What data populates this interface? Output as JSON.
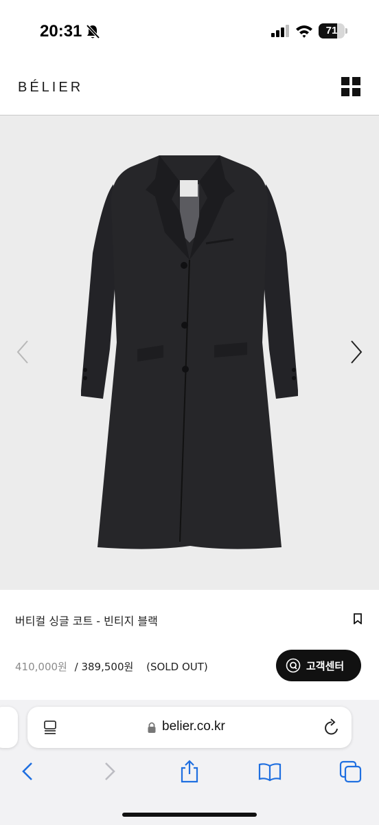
{
  "status_bar": {
    "time": "20:31",
    "battery_level": "71",
    "battery_fraction": 0.71
  },
  "site": {
    "logo": "BÉLIER"
  },
  "product": {
    "name": "버티컬 싱글 코트 - 빈티지 블랙",
    "original_price": "410,000원",
    "price_separator": "/",
    "sale_price": "389,500원",
    "status": "(SOLD OUT)"
  },
  "customer_service": {
    "label": "고객센터"
  },
  "browser": {
    "url": "belier.co.kr"
  },
  "colors": {
    "accent": "#111111",
    "gallery_background": "#ececec",
    "original_price": "#8b8b8b",
    "ios_blue": "#1f6fe0"
  }
}
